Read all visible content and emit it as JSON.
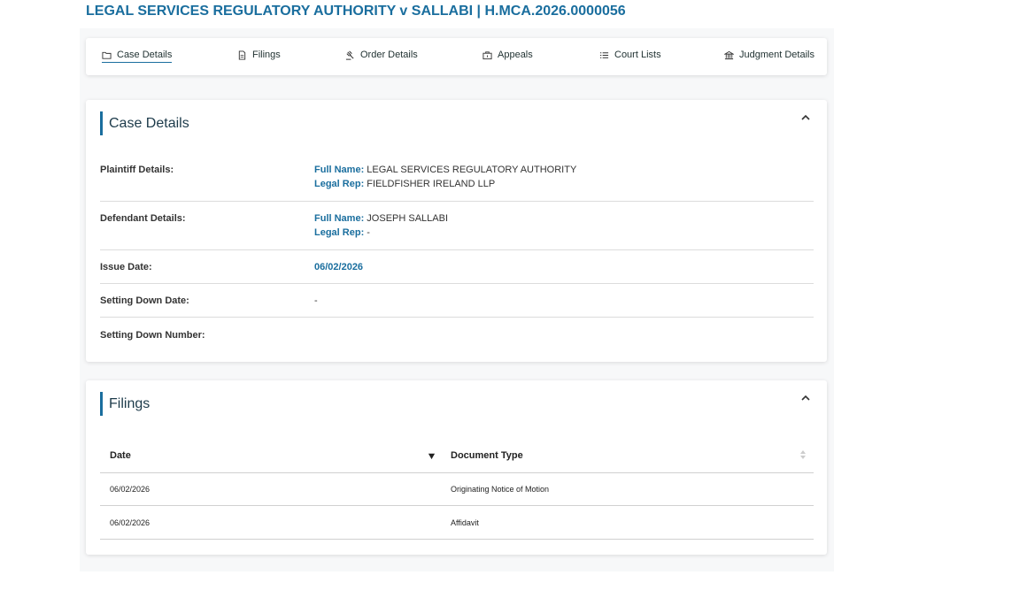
{
  "page": {
    "title": "LEGAL SERVICES REGULATORY AUTHORITY v SALLABI | H.MCA.2026.0000056"
  },
  "tabs": [
    {
      "label": "Case Details",
      "icon": "folder-icon",
      "active": true
    },
    {
      "label": "Filings",
      "icon": "document-icon"
    },
    {
      "label": "Order Details",
      "icon": "gavel-icon"
    },
    {
      "label": "Appeals",
      "icon": "briefcase-icon"
    },
    {
      "label": "Court Lists",
      "icon": "list-icon"
    },
    {
      "label": "Judgment Details",
      "icon": "courthouse-icon"
    }
  ],
  "case_details": {
    "heading": "Case Details",
    "plaintiff": {
      "label": "Plaintiff Details:",
      "full_name_key": "Full Name:",
      "full_name": "LEGAL SERVICES REGULATORY AUTHORITY",
      "legal_rep_key": "Legal Rep:",
      "legal_rep": "FIELDFISHER IRELAND LLP"
    },
    "defendant": {
      "label": "Defendant Details:",
      "full_name_key": "Full Name:",
      "full_name": "JOSEPH SALLABI",
      "legal_rep_key": "Legal Rep:",
      "legal_rep": "-"
    },
    "issue_date": {
      "label": "Issue Date:",
      "value": "06/02/2026"
    },
    "setting_down_date": {
      "label": "Setting Down Date:",
      "value": "-"
    },
    "setting_down_number": {
      "label": "Setting Down Number:",
      "value": ""
    }
  },
  "filings": {
    "heading": "Filings",
    "columns": [
      "Date",
      "Document Type"
    ],
    "rows": [
      {
        "date": "06/02/2026",
        "document_type": "Originating Notice of Motion"
      },
      {
        "date": "06/02/2026",
        "document_type": "Affidavit"
      }
    ]
  },
  "colors": {
    "accent": "#1a6e9e",
    "text": "#333333",
    "divider": "#dcdcdc"
  }
}
